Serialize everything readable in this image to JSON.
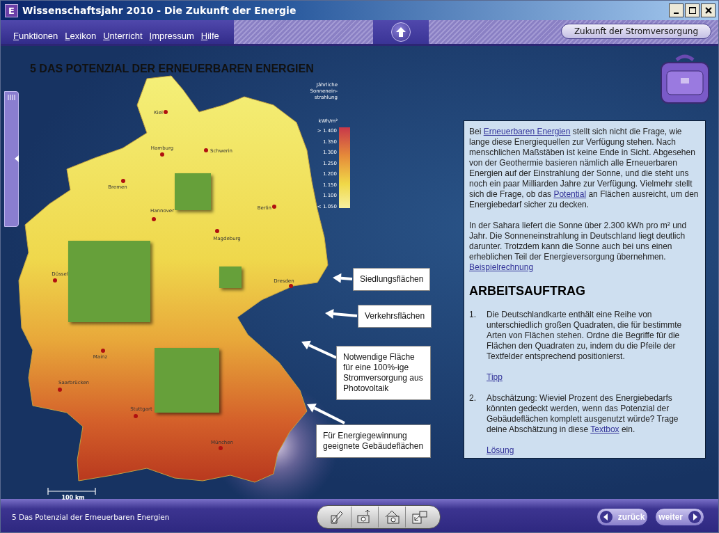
{
  "window": {
    "app_icon": "E",
    "title": "Wissenschaftsjahr 2010 - Die Zukunft der Energie"
  },
  "menu": [
    {
      "label": "Funktionen"
    },
    {
      "label": "Lexikon"
    },
    {
      "label": "Unterricht"
    },
    {
      "label": "Impressum"
    },
    {
      "label": "Hilfe"
    }
  ],
  "header_button": "Zukunft der Stromversorgung",
  "map": {
    "title": "5 DAS POTENZIAL DER ERNEUERBAREN ENERGIEN",
    "legend": {
      "title_lines": [
        "Jährliche",
        "Sonnenein-",
        "strahlung"
      ],
      "unit": "kWh/m²",
      "steps": [
        "> 1.400",
        "1.350",
        "1.300",
        "1.250",
        "1.200",
        "1.150",
        "1.100",
        "< 1.050"
      ]
    },
    "cities": [
      {
        "name": "Kiel"
      },
      {
        "name": "Hamburg"
      },
      {
        "name": "Schwerin"
      },
      {
        "name": "Bremen"
      },
      {
        "name": "Hannover"
      },
      {
        "name": "Berlin"
      },
      {
        "name": "Magdeburg"
      },
      {
        "name": "Düssel"
      },
      {
        "name": "Dresden"
      },
      {
        "name": "Mainz"
      },
      {
        "name": "Saarbrücken"
      },
      {
        "name": "Stuttgart"
      },
      {
        "name": "München"
      }
    ],
    "scale": "100 km"
  },
  "drag_labels": [
    {
      "text": "Siedlungsflächen"
    },
    {
      "text": "Verkehrsflächen"
    },
    {
      "text": "Notwendige Fläche für eine 100%-ige Stromversorgung aus Photovoltaik"
    },
    {
      "text": "Für Energiegewinnung geeignete Gebäudeflächen"
    }
  ],
  "panel": {
    "paragraphs": [
      [
        {
          "kind": "text",
          "text": "Bei "
        },
        {
          "kind": "link",
          "text": "Erneuerbaren Energien"
        },
        {
          "kind": "text",
          "text": " stellt sich nicht die Frage, wie lange diese Energiequellen zur Verfügung stehen. Nach menschlichen Maßstäben ist keine Ende in Sicht. Abgesehen von der Geothermie basieren nämlich alle Erneuerbaren Energien auf der Einstrahlung der Sonne, und die steht uns noch ein paar Milliarden Jahre zur Verfügung. Vielmehr stellt sich die Frage, ob das "
        },
        {
          "kind": "link",
          "text": "Potential"
        },
        {
          "kind": "text",
          "text": " an Flächen ausreicht, um den Energiebedarf sicher zu decken."
        }
      ],
      [
        {
          "kind": "text",
          "text": "In der Sahara liefert die Sonne über 2.300 kWh pro m² und Jahr. Die Sonneneinstrahlung in Deutschland liegt deutlich darunter. Trotzdem kann die Sonne auch bei uns einen erheblichen Teil der Energieversorgung übernehmen."
        },
        {
          "kind": "link_block",
          "text": "Beispielrechnung"
        }
      ]
    ],
    "heading": "ARBEITSAUFTRAG",
    "tasks": [
      {
        "number": "1.",
        "parts": [
          {
            "kind": "text",
            "text": "Die Deutschlandkarte enthält eine Reihe von unterschiedlich großen Quadraten, die für bestimmte Arten von Flächen stehen. Ordne die Begriffe für die Flächen den Quadraten zu, indem du die Pfeile der Textfelder entsprechend positionierst."
          }
        ],
        "link": "Tipp"
      },
      {
        "number": "2.",
        "parts": [
          {
            "kind": "text",
            "text": "Abschätzung: Wieviel Prozent des Energiebedarfs könnten gedeckt werden, wenn das Potenzial der Gebäudeflächen komplett ausgenutzt würde? Trage deine Abschätzung in diese "
          },
          {
            "kind": "link",
            "text": "Textbox"
          },
          {
            "kind": "text",
            "text": " ein."
          }
        ],
        "link": "Lösung"
      }
    ]
  },
  "status_bar": {
    "text": "5 Das Potenzial der Erneuerbaren Energien"
  },
  "nav": [
    {
      "kind": "back",
      "label": "zurück"
    },
    {
      "kind": "forward",
      "label": "weiter"
    }
  ]
}
